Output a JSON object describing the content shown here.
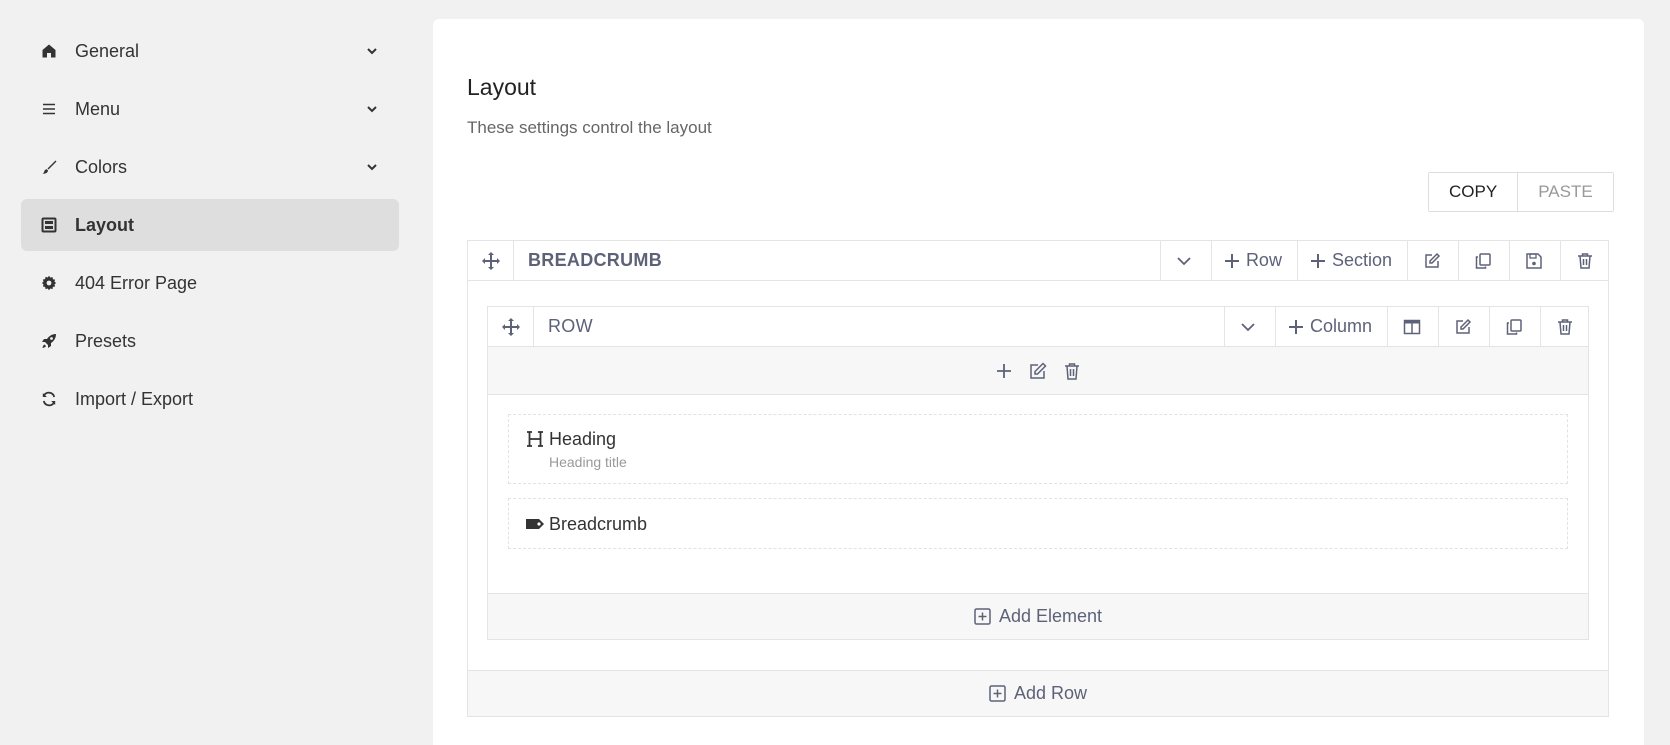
{
  "sidebar": {
    "items": [
      {
        "label": "General",
        "icon": "home-icon",
        "expandable": true,
        "active": false
      },
      {
        "label": "Menu",
        "icon": "menu-icon",
        "expandable": true,
        "active": false
      },
      {
        "label": "Colors",
        "icon": "brush-icon",
        "expandable": true,
        "active": false
      },
      {
        "label": "Layout",
        "icon": "layout-icon",
        "expandable": false,
        "active": true
      },
      {
        "label": "404 Error Page",
        "icon": "gear-icon",
        "expandable": false,
        "active": false
      },
      {
        "label": "Presets",
        "icon": "rocket-icon",
        "expandable": false,
        "active": false
      },
      {
        "label": "Import / Export",
        "icon": "sync-icon",
        "expandable": false,
        "active": false
      }
    ]
  },
  "main": {
    "title": "Layout",
    "description": "These settings control the layout",
    "copy_label": "COPY",
    "paste_label": "PASTE",
    "section": {
      "title": "BREADCRUMB",
      "add_row_label": "Row",
      "add_section_label": "Section",
      "add_row_footer": "Add Row",
      "row": {
        "title": "ROW",
        "add_column_label": "Column",
        "add_element_label": "Add Element",
        "elements": [
          {
            "title": "Heading",
            "subtitle": "Heading title",
            "icon": "heading-icon"
          },
          {
            "title": "Breadcrumb",
            "icon": "tag-icon"
          }
        ]
      }
    }
  },
  "colors": {
    "accent": "#5d6278",
    "active_bg": "#dedede",
    "page_bg": "#f1f1f1"
  }
}
